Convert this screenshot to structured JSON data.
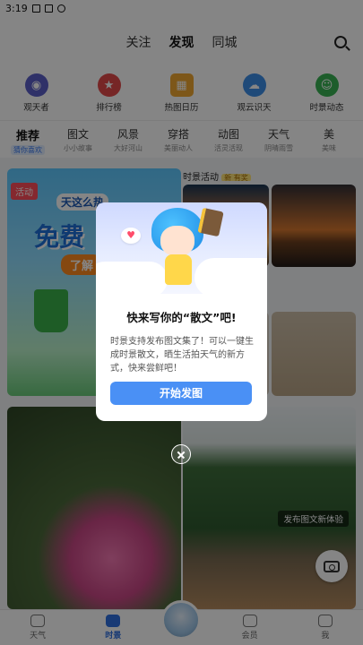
{
  "status_bar": {
    "time": "3:19"
  },
  "header": {
    "tabs": [
      {
        "label": "关注",
        "active": false
      },
      {
        "label": "发现",
        "active": true
      },
      {
        "label": "同城",
        "active": false
      }
    ]
  },
  "quick_links": [
    {
      "label": "观天者",
      "icon": "eye-icon",
      "color": "#5b5fc7"
    },
    {
      "label": "排行榜",
      "icon": "trophy-icon",
      "color": "#e24a4a"
    },
    {
      "label": "热图日历",
      "icon": "calendar-icon",
      "color": "#f0a730"
    },
    {
      "label": "观云识天",
      "icon": "cloud-icon",
      "color": "#3d8ee8"
    },
    {
      "label": "时景动态",
      "icon": "smile-icon",
      "color": "#38b354"
    }
  ],
  "categories": [
    {
      "title": "推荐",
      "sub": "猜你喜欢",
      "active": true
    },
    {
      "title": "图文",
      "sub": "小小故事",
      "active": false
    },
    {
      "title": "风景",
      "sub": "大好河山",
      "active": false
    },
    {
      "title": "穿搭",
      "sub": "美丽动人",
      "active": false
    },
    {
      "title": "动图",
      "sub": "活灵活现",
      "active": false
    },
    {
      "title": "天气",
      "sub": "阴晴雨雪",
      "active": false
    },
    {
      "title": "美",
      "sub": "美味",
      "active": false
    }
  ],
  "feed": {
    "activity_tag": "活动",
    "promo_top": "天这么热",
    "promo_main": "免费",
    "promo_sub": "了解",
    "section_label": "时景活动",
    "section_badge": "新 有奖",
    "publish_tip": "发布图文新体验"
  },
  "bottom_nav": [
    {
      "label": "天气",
      "active": false
    },
    {
      "label": "时景",
      "active": true
    },
    {
      "label": "会员",
      "active": false
    },
    {
      "label": "我",
      "active": false
    }
  ],
  "modal": {
    "title": "快来写你的“散文”吧!",
    "body": "时景支持发布图文集了！可以一键生成时景散文，晒生活拍天气的新方式，快来尝鲜吧！",
    "cta": "开始发图"
  },
  "colors": {
    "accent": "#4a90f5",
    "activity_tag": "#ff4d5a"
  }
}
